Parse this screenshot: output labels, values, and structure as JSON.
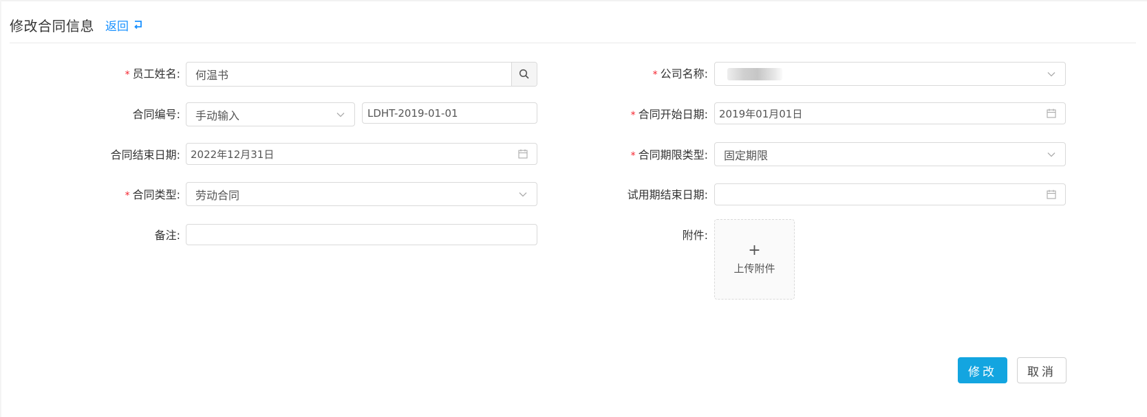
{
  "header": {
    "title": "修改合同信息",
    "back_label": "返回"
  },
  "form": {
    "employee_name": {
      "label": "员工姓名:",
      "required": true,
      "value": "何温书",
      "icon": "search-icon"
    },
    "company_name": {
      "label": "公司名称:",
      "required": true,
      "value": ""
    },
    "contract_number": {
      "label": "合同编号:",
      "required": false,
      "mode_value": "手动输入",
      "number_value": "LDHT-2019-01-01"
    },
    "start_date": {
      "label": "合同开始日期:",
      "required": true,
      "value": "2019年01月01日"
    },
    "end_date": {
      "label": "合同结束日期:",
      "required": false,
      "value": "2022年12月31日"
    },
    "term_type": {
      "label": "合同期限类型:",
      "required": true,
      "value": "固定期限"
    },
    "contract_type": {
      "label": "合同类型:",
      "required": true,
      "value": "劳动合同"
    },
    "probation_end_date": {
      "label": "试用期结束日期:",
      "required": false,
      "value": ""
    },
    "remarks": {
      "label": "备注:",
      "required": false,
      "value": ""
    },
    "attachment": {
      "label": "附件:",
      "upload_icon": "+",
      "upload_label": "上传附件"
    }
  },
  "actions": {
    "submit_label": "修改",
    "cancel_label": "取消"
  },
  "colors": {
    "primary": "#13a5e0",
    "link": "#1890ff",
    "required": "#f5222d",
    "border": "#d9d9d9"
  }
}
